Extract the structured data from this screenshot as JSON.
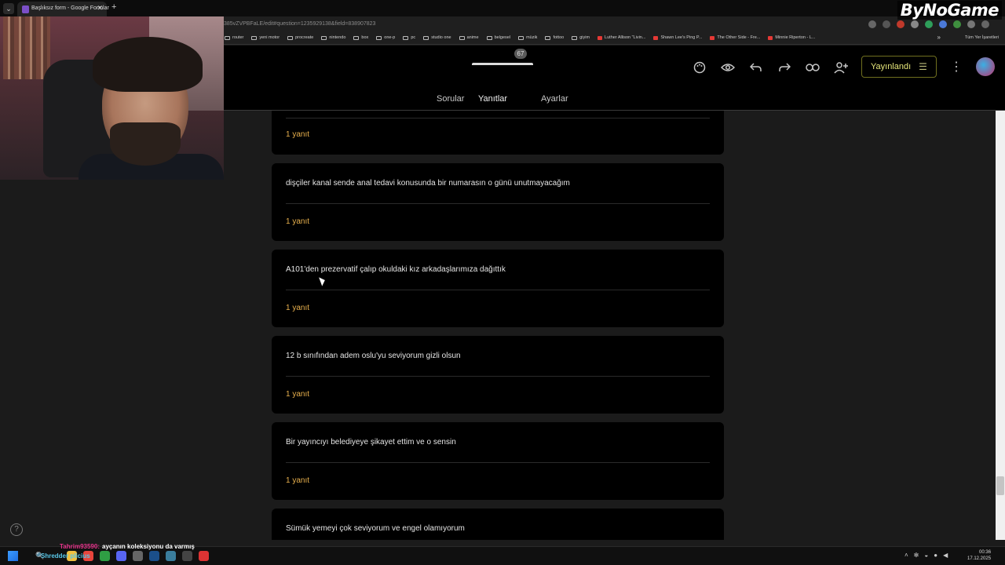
{
  "browser": {
    "tab_title": "Başlıksız form - Google Formlar",
    "tab_close": "✕",
    "new_tab": "+",
    "url": "385vZVPBFaLE/edit#question=1235929138&field=838907823",
    "bookmarks": [
      {
        "label": "router",
        "kind": "folder"
      },
      {
        "label": "yeni motor",
        "kind": "folder"
      },
      {
        "label": "procreate",
        "kind": "folder"
      },
      {
        "label": "nintendo",
        "kind": "folder"
      },
      {
        "label": "box",
        "kind": "folder"
      },
      {
        "label": "one-p",
        "kind": "folder"
      },
      {
        "label": "pc",
        "kind": "folder"
      },
      {
        "label": "studio one",
        "kind": "folder"
      },
      {
        "label": "anime",
        "kind": "folder"
      },
      {
        "label": "belgesel",
        "kind": "folder"
      },
      {
        "label": "müzik",
        "kind": "folder"
      },
      {
        "label": "fottoo",
        "kind": "folder"
      },
      {
        "label": "giyim",
        "kind": "folder"
      },
      {
        "label": "Luther Allison \"Livin...",
        "kind": "youtube"
      },
      {
        "label": "Shawn Lee's Ping P...",
        "kind": "youtube"
      },
      {
        "label": "The Other Side - Fre...",
        "kind": "youtube"
      },
      {
        "label": "Minnie Riperton - L...",
        "kind": "youtube"
      }
    ],
    "bookmarks_more": "»",
    "other_bookmarks": "Tüm Yer İşaretleri"
  },
  "logo": "ByNoGame",
  "header": {
    "publish_label": "Yayınlandı",
    "more_icon": "more-vert-icon"
  },
  "tabs": {
    "questions": "Sorular",
    "responses": "Yanıtlar",
    "responses_count": "67",
    "settings": "Ayarlar"
  },
  "responses": [
    {
      "text": "",
      "count": "1 yanıt"
    },
    {
      "text": "dişçiler kanal sende anal tedavi konusunda bir numarasın o günü unutmayacağım",
      "count": "1 yanıt"
    },
    {
      "text": "A101'den prezervatif çalıp okuldaki kız arkadaşlarımıza dağıttık",
      "count": "1 yanıt"
    },
    {
      "text": "12 b sınıfından adem oslu'yu seviyorum gizli olsun",
      "count": "1 yanıt"
    },
    {
      "text": "Bir yayıncıyı belediyeye şikayet ettim ve o sensin",
      "count": "1 yanıt"
    },
    {
      "text": "Sümük yemeyi çok seviyorum ve engel olamıyorum",
      "count": ""
    }
  ],
  "help_glyph": "?",
  "chat": {
    "user": "Tahrim93590:",
    "message": "ayçanın koleksiyonu da varmış",
    "second_line": "Shredder  plicius"
  },
  "taskbar": {
    "search_glyph": "🔍",
    "time": "00:36",
    "date": "17.12.2025"
  },
  "colors": {
    "accent_orange": "#e8b04d",
    "publish_text": "#e6e67a"
  }
}
